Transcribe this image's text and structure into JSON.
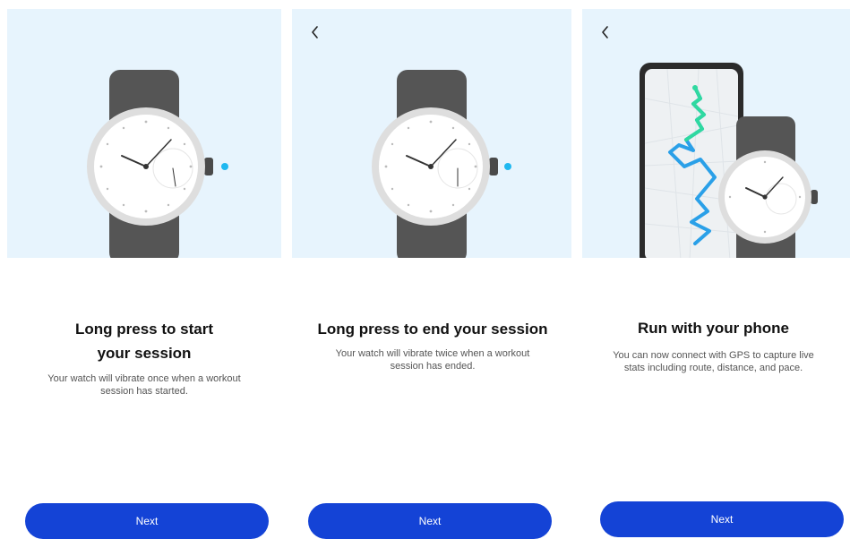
{
  "screens": [
    {
      "title_line1": "Long press to start",
      "title_line2": "your session",
      "description_line1": "Your watch will vibrate once when a workout",
      "description_line2": "session has started.",
      "button_label": "Next"
    },
    {
      "back_icon": "chevron-left-icon",
      "title": "Long press to end your session",
      "description_line1": "Your watch will vibrate twice when a workout",
      "description_line2": "session has ended.",
      "button_label": "Next"
    },
    {
      "back_icon": "chevron-left-icon",
      "title": "Run with your phone",
      "description_line1": "You can now connect with GPS to capture live",
      "description_line2": "stats including route, distance, and pace.",
      "button_label": "Next"
    }
  ],
  "colors": {
    "hero_background": "#e7f4fd",
    "button": "#1443d6",
    "indicator_dot": "#1fb8f0",
    "strap": "#555555"
  }
}
